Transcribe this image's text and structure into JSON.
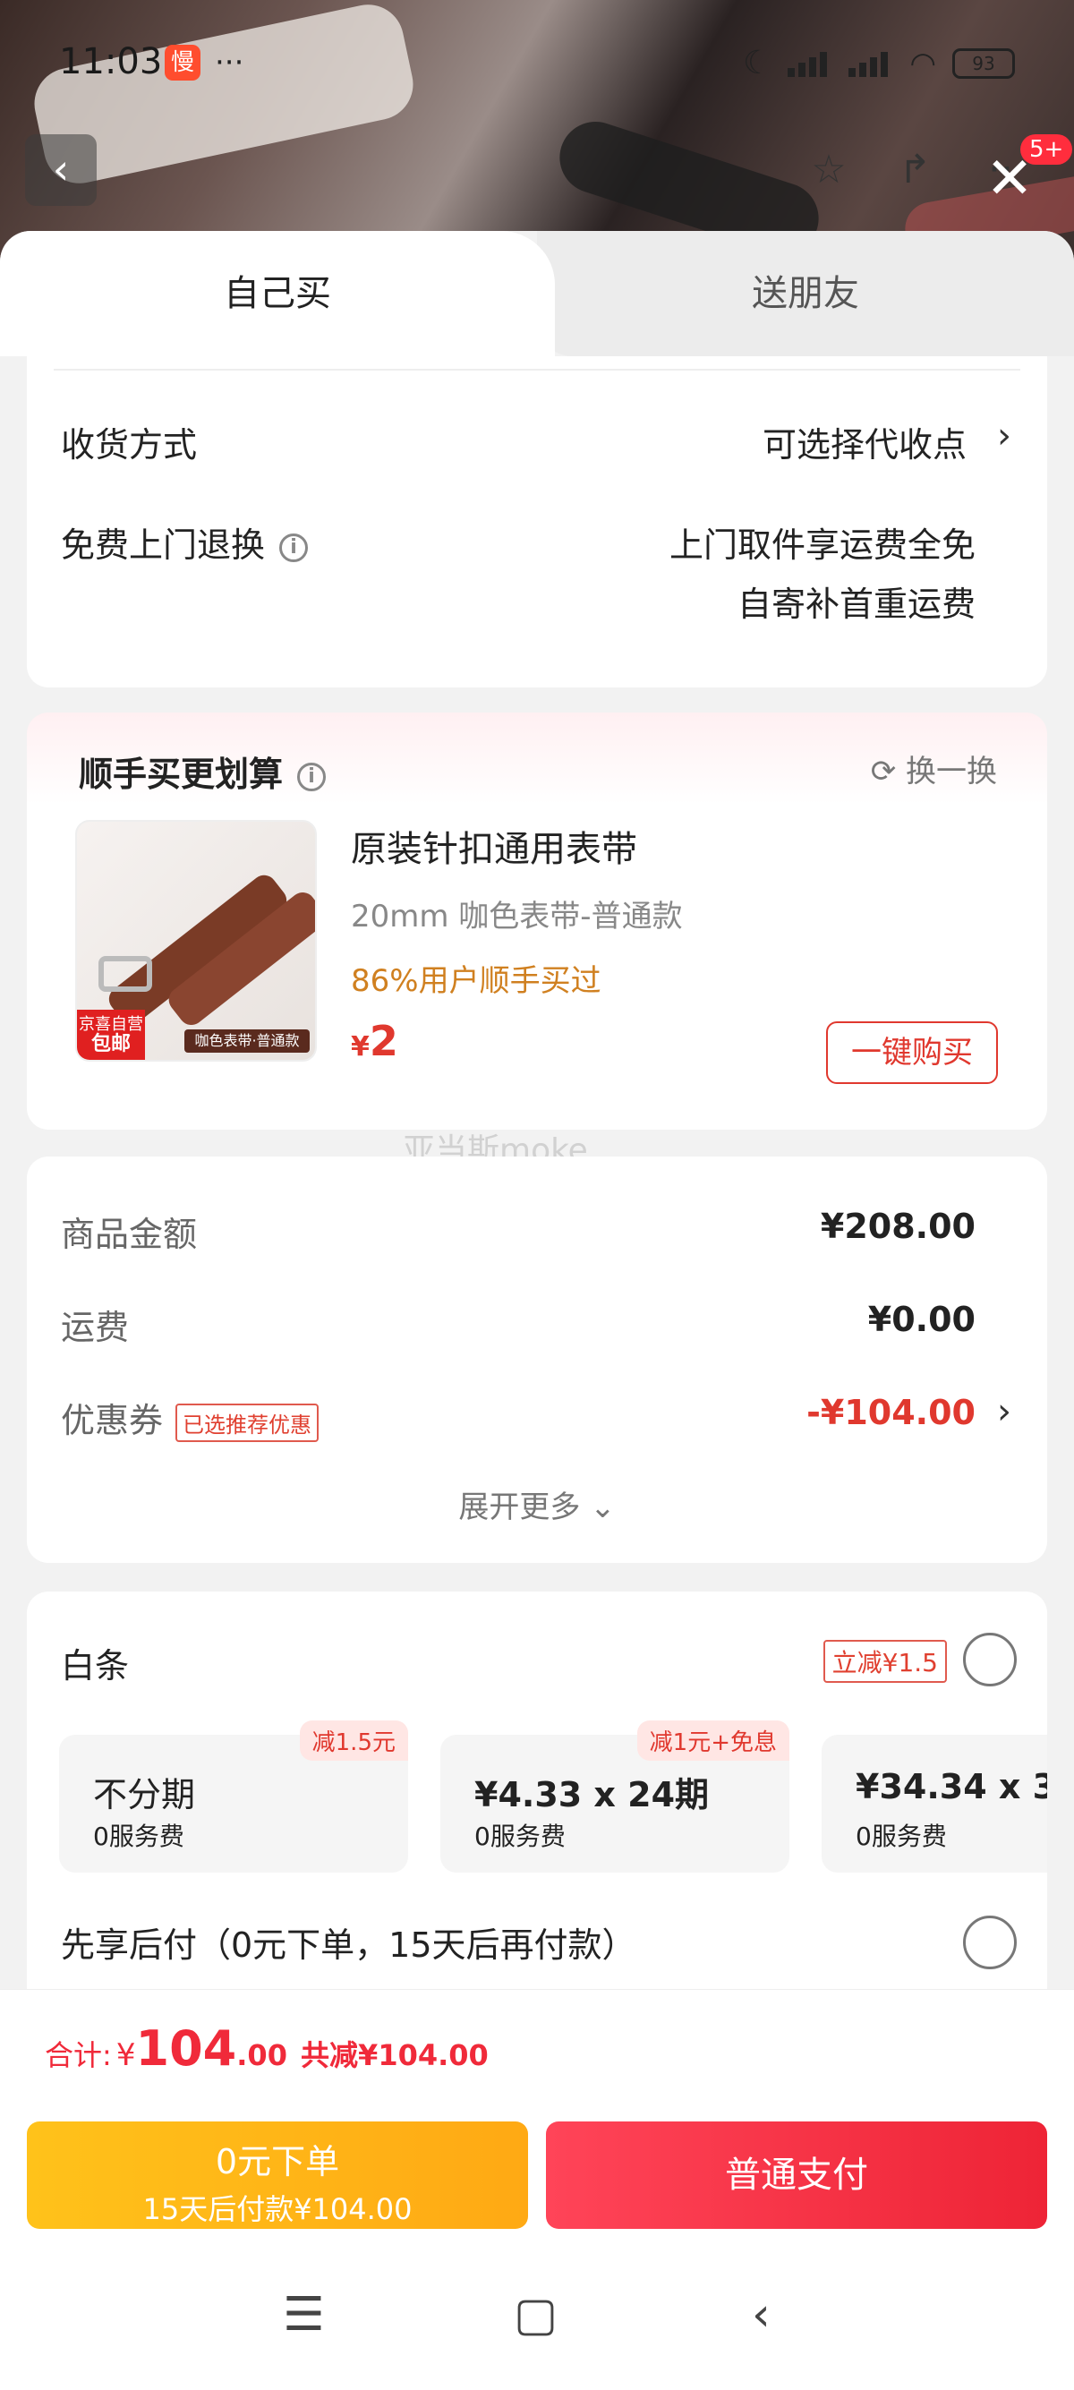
{
  "status_bar": {
    "time": "11:03",
    "app_badge": "慢",
    "dots": "···",
    "network": "HD",
    "battery": "93"
  },
  "top_bar": {
    "back": "‹",
    "cart_count": "5+",
    "close": "✕"
  },
  "tabs": {
    "self": "自己买",
    "friend": "送朋友"
  },
  "delivery": {
    "method_label": "收货方式",
    "method_value": "可选择代收点",
    "return_label": "免费上门退换",
    "return_value_1": "上门取件享运费全免",
    "return_value_2": "自寄补首重运费"
  },
  "upsell": {
    "title": "顺手买更划算",
    "refresh": "换一换",
    "product_name": "原装针扣通用表带",
    "variant": "20mm 咖色表带-普通款",
    "social_proof": "86%用户顺手买过",
    "price_symbol": "¥",
    "price": "2",
    "tag_jd_1": "京喜自营",
    "tag_jd_2": "包邮",
    "tag_variant": "咖色表带·普通款",
    "buy_button": "一键购买"
  },
  "watermark": "亚当斯moke",
  "summary": {
    "goods_label": "商品金额",
    "goods_value": "¥208.00",
    "shipping_label": "运费",
    "shipping_value": "¥0.00",
    "coupon_label": "优惠券",
    "coupon_tag": "已选推荐优惠",
    "coupon_value": "-¥104.00",
    "expand": "展开更多"
  },
  "baitiao": {
    "label": "白条",
    "discount_tag": "立减¥1.5",
    "plans": [
      {
        "main": "不分期",
        "sub": "0服务费",
        "promo": "减1.5元"
      },
      {
        "main": "¥4.33 x 24期",
        "sub": "0服务费",
        "promo": "减1元+免息"
      },
      {
        "main": "¥34.34 x 3",
        "sub": "0服务费",
        "promo": ""
      }
    ],
    "pay_later": "先享后付（0元下单，15天后再付款）"
  },
  "total": {
    "label": "合计:",
    "symbol": "¥",
    "amount_int": "104",
    "amount_dec": ".00",
    "saved": "共减¥104.00"
  },
  "buttons": {
    "later_main": "0元下单",
    "later_sub": "15天后付款¥104.00",
    "pay": "普通支付"
  },
  "colors": {
    "accent_red": "#e0382e",
    "price_red": "#f02a3a",
    "later_yellow": "#ffb81a",
    "social_orange": "#d08020"
  }
}
